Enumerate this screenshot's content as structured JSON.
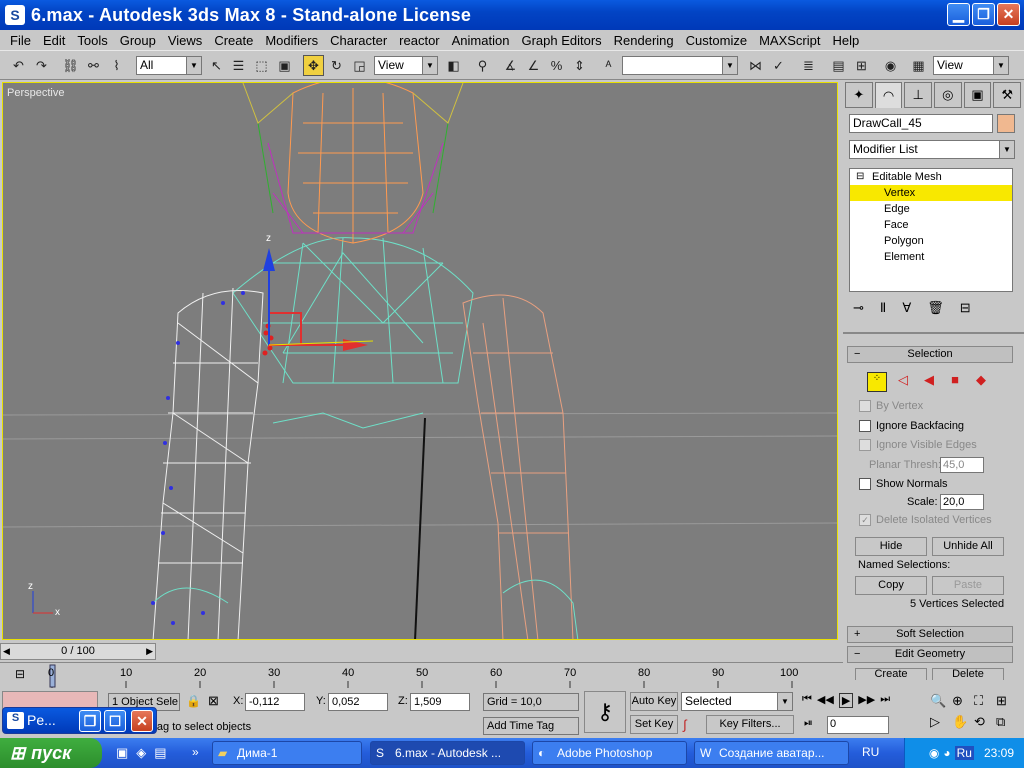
{
  "window": {
    "title": "6.max - Autodesk 3ds Max 8  - Stand-alone License",
    "app_icon": "S"
  },
  "menu": [
    "File",
    "Edit",
    "Tools",
    "Group",
    "Views",
    "Create",
    "Modifiers",
    "Character",
    "reactor",
    "Animation",
    "Graph Editors",
    "Rendering",
    "Customize",
    "MAXScript",
    "Help"
  ],
  "toolbar": {
    "filter": "All",
    "ref_coord": "View",
    "named_sel": "",
    "view2": "View"
  },
  "viewport": {
    "label": "Perspective",
    "axis_z": "z",
    "axis_x": "x"
  },
  "cmd": {
    "object_name": "DrawCall_45",
    "modifier_list": "Modifier List",
    "stack": [
      "Editable Mesh",
      "Vertex",
      "Edge",
      "Face",
      "Polygon",
      "Element"
    ],
    "selection_rollout": "Selection",
    "by_vertex": "By Vertex",
    "ignore_backfacing": "Ignore Backfacing",
    "ignore_visible_edges": "Ignore Visible Edges",
    "planar_thresh_label": "Planar Thresh:",
    "planar_thresh": "45,0",
    "show_normals": "Show Normals",
    "scale_label": "Scale:",
    "scale": "20,0",
    "delete_isolated": "Delete Isolated Vertices",
    "hide": "Hide",
    "unhide_all": "Unhide All",
    "named_selections": "Named Selections:",
    "copy": "Copy",
    "paste": "Paste",
    "selected_count": "5 Vertices Selected",
    "soft_selection": "Soft Selection",
    "edit_geometry": "Edit Geometry",
    "create": "Create",
    "delete": "Delete"
  },
  "time": {
    "slider": "0 / 100",
    "ticks": [
      "0",
      "10",
      "20",
      "30",
      "40",
      "50",
      "60",
      "70",
      "80",
      "90",
      "100"
    ]
  },
  "status": {
    "objects": "1 Object Sele",
    "x_label": "X:",
    "x": "-0,112",
    "y_label": "Y:",
    "y": "0,052",
    "z_label": "Z:",
    "z": "1,509",
    "grid": "Grid = 10,0",
    "prompt": "ick-and-drag to select objects",
    "add_time_tag": "Add Time Tag",
    "auto_key": "Auto Key",
    "set_key": "Set Key",
    "selected": "Selected",
    "key_filters": "Key Filters...",
    "frame": "0"
  },
  "minimized": {
    "title": "Pe..."
  },
  "taskbar": {
    "start": "пуск",
    "items": [
      "Дима-1",
      "6.max - Autodesk ...",
      "Adobe Photoshop",
      "Создание аватар..."
    ],
    "lang": "RU",
    "lang2": "Ru",
    "clock": "23:09"
  }
}
